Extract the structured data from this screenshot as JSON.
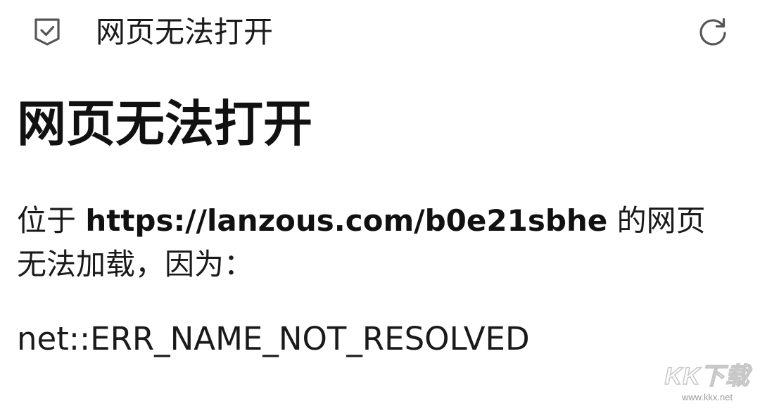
{
  "top_bar": {
    "shield_icon": "shield-check-icon",
    "title": "网页无法打开",
    "reload_icon": "reload-icon"
  },
  "main": {
    "heading": "网页无法打开",
    "message_prefix": "位于 ",
    "url": "https://lanzous.com/b0e21sbhe",
    "message_suffix": " 的网页无法加载，因为：",
    "error_code": "net::ERR_NAME_NOT_RESOLVED"
  },
  "watermark": {
    "logo_text": "KK下载",
    "url": "www.kkx.net"
  },
  "colors": {
    "background": "#ffffff",
    "text": "#111111",
    "icon": "#555555"
  }
}
